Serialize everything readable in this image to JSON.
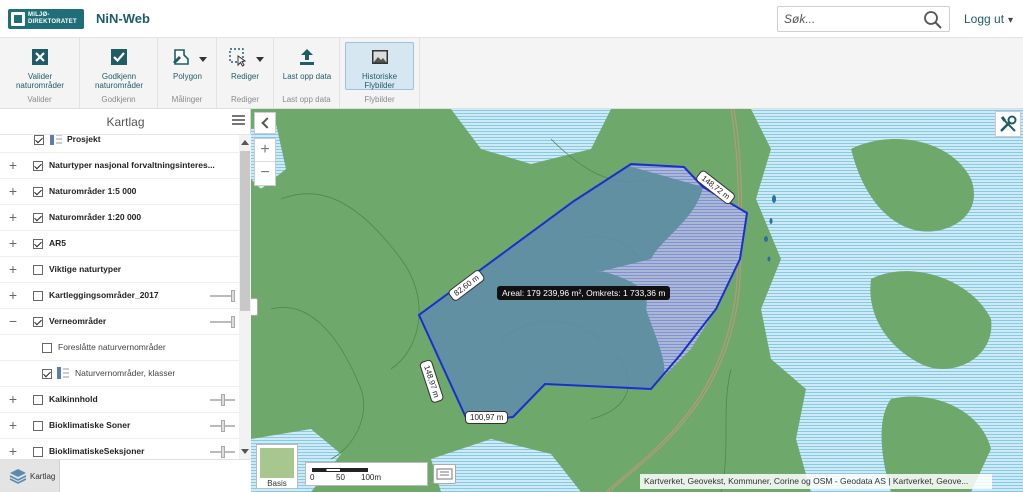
{
  "header": {
    "logo_text_1": "MILJØ-",
    "logo_text_2": "DIREKTORATET",
    "app_title": "NiN-Web",
    "search_placeholder": "Søk...",
    "logout_label": "Logg ut"
  },
  "ribbon": {
    "groups": [
      {
        "group_label": "Valider",
        "button_label_1": "Valider",
        "button_label_2": "naturområder",
        "icon": "validate-x-icon"
      },
      {
        "group_label": "Godkjenn",
        "button_label_1": "Godkjenn",
        "button_label_2": "naturområder",
        "icon": "approve-check-icon"
      },
      {
        "group_label": "Målinger",
        "button_label_1": "Polygon",
        "button_label_2": "",
        "icon": "polygon-measure-icon"
      },
      {
        "group_label": "Rediger",
        "button_label_1": "Rediger",
        "button_label_2": "",
        "icon": "edit-select-icon"
      },
      {
        "group_label": "Last opp data",
        "button_label_1": "Last opp data",
        "button_label_2": "",
        "icon": "upload-icon"
      },
      {
        "group_label": "Flybilder",
        "button_label_1": "Historiske",
        "button_label_2": "Flybilder",
        "icon": "aerial-photo-icon",
        "active": true
      }
    ]
  },
  "panel": {
    "title": "Kartlag",
    "footer_tab": "Kartlag",
    "layers": [
      {
        "name": "Prosjekt",
        "checked": true,
        "expand": "",
        "has_legend_icon": true
      },
      {
        "name": "Naturtyper nasjonal forvaltningsinteres...",
        "checked": true,
        "expand": "+"
      },
      {
        "name": "Naturområder 1:5 000",
        "checked": true,
        "expand": "+"
      },
      {
        "name": "Naturområder 1:20 000",
        "checked": true,
        "expand": "+"
      },
      {
        "name": "AR5",
        "checked": true,
        "expand": "+"
      },
      {
        "name": "Viktige naturtyper",
        "checked": false,
        "expand": "+"
      },
      {
        "name": "Kartleggingsområder_2017",
        "checked": false,
        "expand": "+",
        "opacity_slider": 1.0
      },
      {
        "name": "Verneområder",
        "checked": true,
        "expand": "−",
        "opacity_slider": 1.0
      },
      {
        "name": "Foreslåtte naturvernområder",
        "checked": false,
        "expand": "",
        "child": true
      },
      {
        "name": "Naturvernområder, klasser",
        "checked": true,
        "expand": "",
        "child": true,
        "has_legend_icon": true
      },
      {
        "name": "Kalkinnhold",
        "checked": false,
        "expand": "+",
        "opacity_slider": 0.5
      },
      {
        "name": "Bioklimatiske Soner",
        "checked": false,
        "expand": "+",
        "opacity_slider": 0.5
      },
      {
        "name": "BioklimatiskeSeksjoner",
        "checked": false,
        "expand": "+",
        "opacity_slider": 0.5
      }
    ]
  },
  "map": {
    "measurements": {
      "top_right_edge": "148,72 m",
      "left_upper_edge": "82,60 m",
      "left_lower_edge": "148,97 m",
      "bottom_edge": "100,97 m",
      "area_label": "Areal: 179 239,96 m², Omkrets: 1 733,36 m"
    },
    "basemap_label": "Basis",
    "scale": {
      "t0": "0",
      "t1": "50",
      "t2": "100m"
    },
    "attribution": "Kartverket, Geovekst, Kommuner, Corine og OSM - Geodata AS | Kartverket, Geove...",
    "zoom_in": "+",
    "zoom_out": "−",
    "colors": {
      "forest": "#6ea86a",
      "water": "#bfe4f2",
      "polygon_stroke": "#1c2ed1",
      "polygon_fill": "#5d8fb1"
    }
  }
}
